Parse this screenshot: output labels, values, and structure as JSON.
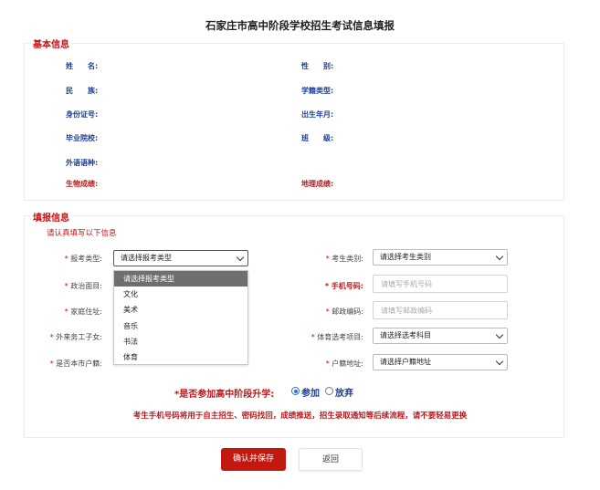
{
  "page": {
    "title": "石家庄市高中阶段学校招生考试信息填报"
  },
  "basic_info": {
    "heading": "基本信息",
    "fields": {
      "name": "姓　　名:",
      "gender": "性　　别:",
      "ethnicity": "民　　族:",
      "roll_type": "学籍类型:",
      "id_number": "身份证号:",
      "birth_date": "出生年月:",
      "school": "毕业院校:",
      "class": "班　　级:",
      "language": "外语语种:",
      "biology": "生物成绩:",
      "geography": "地理成绩:"
    }
  },
  "fill_info": {
    "heading": "填报信息",
    "hint": "请认真填写以下信息",
    "exam_type": {
      "label": "报考类型:",
      "value": "请选择报考类型",
      "options": [
        "请选择报考类型",
        "文化",
        "美术",
        "音乐",
        "书法",
        "体育"
      ]
    },
    "candidate_category": {
      "label": "考生类别:",
      "value": "请选择考生类别"
    },
    "political_status": {
      "label": "政治面目:"
    },
    "phone": {
      "label": "手机号码:",
      "placeholder": "请填写手机号码"
    },
    "home_address": {
      "label": "家庭住址:"
    },
    "postal_code": {
      "label": "邮政编码:",
      "placeholder": "请填写邮政编码"
    },
    "migrant_child": {
      "label": "外来务工子女:"
    },
    "pe_item": {
      "label": "体育选考项目:",
      "value": "请选择选考科目"
    },
    "local_hukou": {
      "label": "是否本市户籍:"
    },
    "hukou_address": {
      "label": "户籍地址:",
      "value": "请选择户籍地址"
    },
    "star": "*"
  },
  "promotion": {
    "question": "*是否参加高中阶段升学:",
    "option_yes": "参加",
    "option_no": "放弃",
    "selected": "参加"
  },
  "warning": "考生手机号码将用于自主招生、密码找回，成绩推送，招生录取通知等后续流程，请不要轻易更换",
  "buttons": {
    "save": "确认并保存",
    "back": "返回"
  },
  "colors": {
    "accent_red": "#c0161b",
    "label_blue": "#1f3f96",
    "primary_button": "#c3180f"
  }
}
